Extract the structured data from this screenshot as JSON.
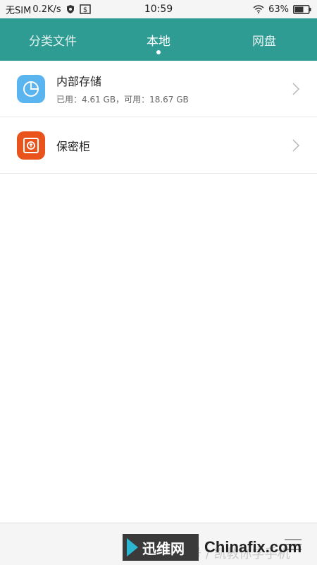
{
  "status_bar": {
    "carrier": "无SIM",
    "speed": "0.2K/s",
    "time": "10:59",
    "battery": "63%"
  },
  "tabs": [
    {
      "label": "分类文件",
      "active": false
    },
    {
      "label": "本地",
      "active": true
    },
    {
      "label": "网盘",
      "active": false
    }
  ],
  "storage": [
    {
      "title": "内部存储",
      "subtitle": "已用：4.61 GB，可用：18.67 GB",
      "icon": "pie-chart-icon",
      "color": "#5ab4ef"
    },
    {
      "title": "保密柜",
      "subtitle": "",
      "icon": "safe-icon",
      "color": "#e8541c"
    }
  ],
  "watermark": {
    "cn": "迅维网",
    "en": "Chinafix.com",
    "ghost": "头条号 / 凯教你学手机"
  },
  "colors": {
    "header": "#2e9c93",
    "accent_blue": "#5ab4ef",
    "accent_orange": "#e8541c"
  }
}
